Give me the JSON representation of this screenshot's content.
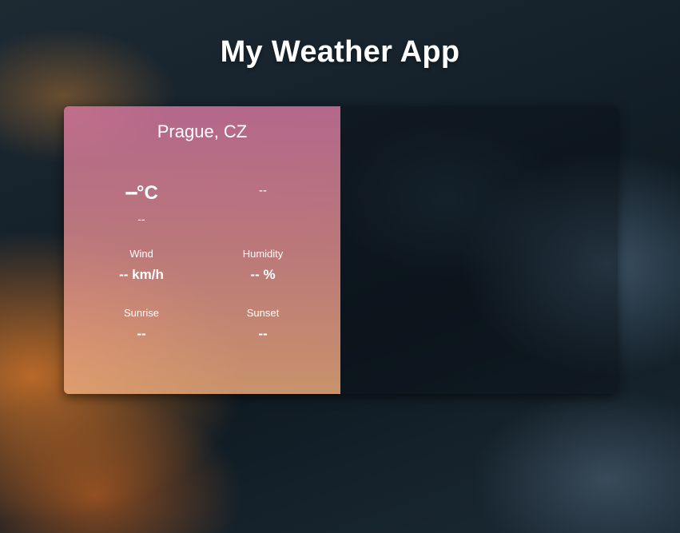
{
  "app": {
    "title": "My Weather App"
  },
  "card": {
    "city": "Prague, CZ",
    "temperature": {
      "value": "--",
      "unit": "°C"
    },
    "description": "--",
    "condition": "--",
    "wind": {
      "label": "Wind",
      "value": "-- km/h"
    },
    "humidity": {
      "label": "Humidity",
      "value": "-- %"
    },
    "sunrise": {
      "label": "Sunrise",
      "value": "--"
    },
    "sunset": {
      "label": "Sunset",
      "value": "--"
    }
  }
}
